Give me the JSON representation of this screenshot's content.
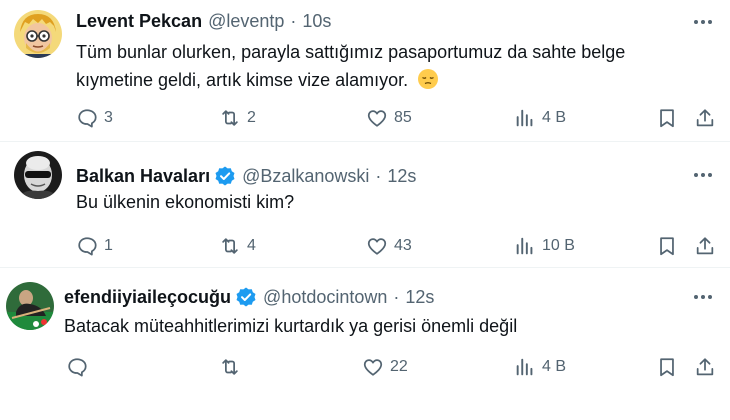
{
  "tweets": [
    {
      "name": "Levent Pekcan",
      "handle": "@leventp",
      "time": "10s",
      "verified": false,
      "text": "Tüm bunlar olurken, parayla sattığımız pasaportumuz da sahte belge kıymetine geldi, artık kimse vize alamıyor.",
      "emoji": "pensive-face",
      "replies": "3",
      "reposts": "2",
      "likes": "85",
      "views": "4 B"
    },
    {
      "name": "Balkan Havaları",
      "handle": "@Bzalkanowski",
      "time": "12s",
      "verified": true,
      "text": "Bu ülkenin ekonomisti kim?",
      "replies": "1",
      "reposts": "4",
      "likes": "43",
      "views": "10 B"
    },
    {
      "name": "efendiiyiaileçocuğu",
      "handle": "@hotdocintown",
      "time": "12s",
      "verified": true,
      "text": "Batacak müteahhitlerimizi kurtardık ya gerisi önemli değil",
      "replies": "",
      "reposts": "",
      "likes": "22",
      "views": "4 B"
    }
  ],
  "separator": "·",
  "colors": {
    "text": "#0f1419",
    "secondary": "#536471",
    "verified": "#1d9bf0",
    "divider": "#eff3f4"
  }
}
